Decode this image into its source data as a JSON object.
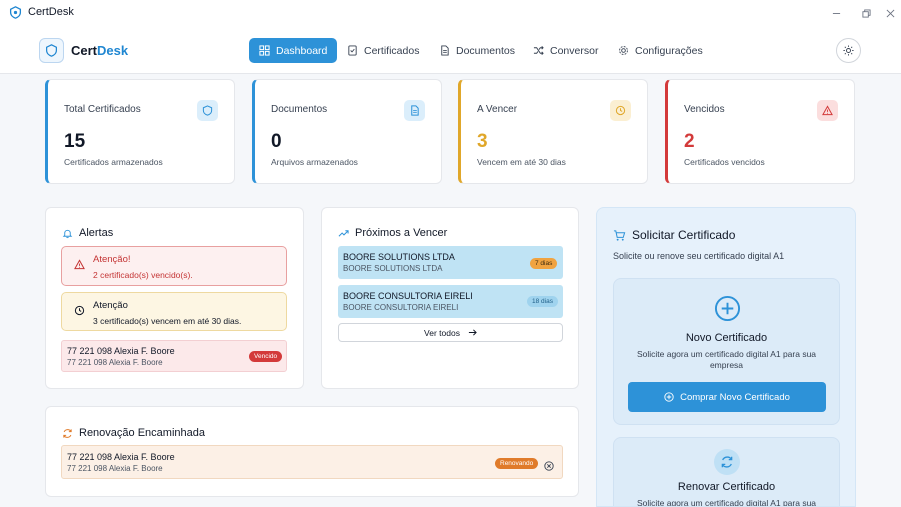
{
  "window": {
    "title": "CertDesk"
  },
  "brand": {
    "name_part1": "Cert",
    "name_part2": "Desk"
  },
  "nav": [
    {
      "label": "Dashboard",
      "icon": "grid-icon",
      "active": true
    },
    {
      "label": "Certificados",
      "icon": "file-check-icon",
      "active": false
    },
    {
      "label": "Documentos",
      "icon": "document-icon",
      "active": false
    },
    {
      "label": "Conversor",
      "icon": "shuffle-icon",
      "active": false
    },
    {
      "label": "Configurações",
      "icon": "gear-icon",
      "active": false
    }
  ],
  "stats": [
    {
      "title": "Total Certificados",
      "value": "15",
      "sub": "Certificados armazenados",
      "icon": "shield-icon",
      "color": "#2d92d8"
    },
    {
      "title": "Documentos",
      "value": "0",
      "sub": "Arquivos armazenados",
      "icon": "document-icon",
      "color": "#2d92d8"
    },
    {
      "title": "A Vencer",
      "value": "3",
      "sub": "Vencem em até 30 dias",
      "icon": "clock-icon",
      "color": "#e0a72a"
    },
    {
      "title": "Vencidos",
      "value": "2",
      "sub": "Certificados vencidos",
      "icon": "warning-icon",
      "color": "#d33a3a"
    }
  ],
  "alerts": {
    "title": "Alertas",
    "items": [
      {
        "title": "Atenção!",
        "text": "2 certificado(s) vencido(s).",
        "type": "danger"
      },
      {
        "title": "Atenção",
        "text": "3 certificado(s) vencem em até 30 dias.",
        "type": "warning"
      }
    ],
    "expired": {
      "line1": "77 221 098 Alexia F. Boore",
      "line2": "77 221 098 Alexia F. Boore",
      "badge": "Vencido"
    }
  },
  "upcoming": {
    "title": "Próximos a Vencer",
    "items": [
      {
        "line1": "BOORE SOLUTIONS LTDA",
        "line2": "BOORE SOLUTIONS LTDA",
        "badge": "7 dias"
      },
      {
        "line1": "BOORE CONSULTORIA EIRELI",
        "line2": "BOORE CONSULTORIA EIRELI",
        "badge": "18 dias"
      }
    ],
    "view_all": "Ver todos"
  },
  "renewal": {
    "title": "Renovação Encaminhada",
    "item": {
      "line1": "77 221 098 Alexia F. Boore",
      "line2": "77 221 098 Alexia F. Boore",
      "badge": "Renovando"
    }
  },
  "request": {
    "title": "Solicitar Certificado",
    "subtitle": "Solicite ou renove seu certificado digital A1",
    "new_card": {
      "title": "Novo Certificado",
      "text": "Solicite agora um certificado digital A1 para sua empresa",
      "button": "Comprar Novo Certificado"
    },
    "renew_card": {
      "title": "Renovar Certificado",
      "text": "Solicite agora um certificado digital A1 para sua"
    }
  }
}
